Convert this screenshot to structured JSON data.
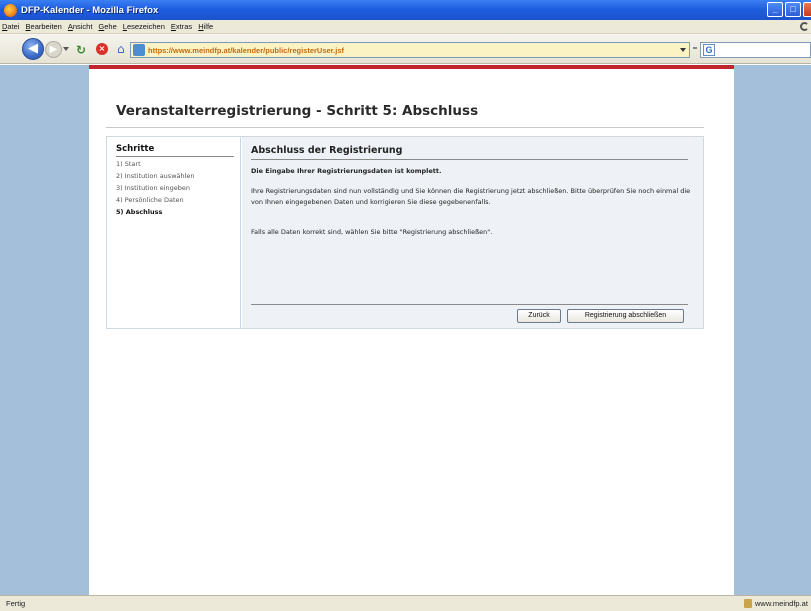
{
  "window": {
    "title": "DFP-Kalender - Mozilla Firefox",
    "minimize": "_",
    "maximize": "□",
    "close": "x"
  },
  "menu": [
    "Datei",
    "Bearbeiten",
    "Ansicht",
    "Gehe",
    "Lesezeichen",
    "Extras",
    "Hilfe"
  ],
  "toolbar": {
    "url": "https://www.meindfp.at/kalender/public/registerUser.jsf",
    "search_engine": "G"
  },
  "page": {
    "title": "Veranstalterregistrierung - Schritt 5: Abschluss",
    "steps_heading": "Schritte",
    "steps": [
      "1) Start",
      "2) Institution auswählen",
      "3) Institution eingeben",
      "4) Persönliche Daten",
      "5) Abschluss"
    ],
    "current_step": 5,
    "panel_heading": "Abschluss der Registrierung",
    "intro": "Die Eingabe Ihrer Registrierungsdaten ist komplett.",
    "para1": "Ihre Registrierungsdaten sind nun vollständig und Sie können die Registrierung jetzt abschließen. Bitte überprüfen Sie noch einmal die von Ihnen eingegebenen Daten und korrigieren Sie diese gegebenenfalls.",
    "para2": "Falls alle Daten korrekt sind, wählen Sie bitte \"Registrierung abschließen\".",
    "back_button": "Zurück",
    "finish_button": "Registrierung abschließen"
  },
  "status": {
    "text": "Fertig",
    "domain": "www.meindfp.at"
  },
  "colors": {
    "accent_red": "#c0262f",
    "page_background": "#a3bfd9",
    "panel_background": "#eef2f6"
  }
}
